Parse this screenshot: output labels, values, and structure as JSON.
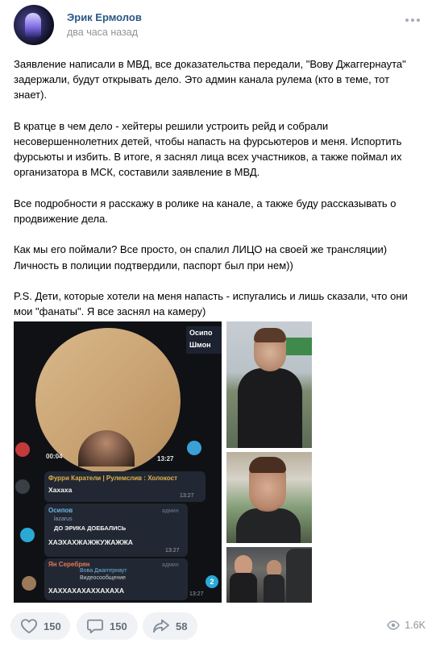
{
  "post": {
    "author": "Эрик Ермолов",
    "time": "два часа назад",
    "paragraphs": [
      "Заявление написали в МВД, все доказательства передали, \"Вову Джаггернаута\"\nзадержали, будут открывать дело. Это админ канала рулема (кто в теме, тот\nзнает).",
      "В кратце в чем дело - хейтеры решили устроить рейд и собрали\nнесовершеннолетних детей, чтобы напасть на фурсьютеров и меня. Испортить\nфурсьюты и избить. В итоге, я заснял лица всех участников, а также поймал их\nорганизатора в МСК, составили заявление в МВД.",
      "Все подробности я расскажу в ролике на канале, а также буду рассказывать о\nпродвижение дела.",
      "Как мы его поймали? Все просто, он спалил ЛИЦО на своей же трансляции)\nЛичность в полиции подтвердили, паспорт был при нем))",
      "P.S. Дети, которые хотели на меня напасть - испугались и лишь сказали, что они\nмои \"фанаты\". Я все заснял на камеру)"
    ]
  },
  "screenshot": {
    "side_label_1": "Осипо",
    "side_label_2": "Шмон",
    "video_duration": "00:04",
    "video_time": "13:27",
    "msg1": {
      "title": "Фурри Каратели | Рулемслив : Холокост",
      "body": "Хахаха",
      "time": "13:27"
    },
    "msg2": {
      "author": "Осипов",
      "role": "админ",
      "reply_name": "lazarus",
      "reply_text": "ДО ЭРИКА ДОЕБАЛИСЬ",
      "body": "ХАЭХАХЖАЖЖУЖАЖЖА",
      "time": "13:27"
    },
    "msg3": {
      "author": "Ян Серебрян",
      "role": "админ",
      "reply_name": "Вова Джаггернаут",
      "reply_text": "Видеосообщение",
      "body": "ХАХХАХАХАХХАХАХА",
      "time": "13:27"
    },
    "badge": "2"
  },
  "actions": {
    "likes": "150",
    "comments": "150",
    "shares": "58",
    "views": "1.6K"
  },
  "colors": {
    "link": "#2a5885",
    "muted": "#939393",
    "button_bg": "#f0f2f5",
    "button_text": "#626d7a"
  }
}
